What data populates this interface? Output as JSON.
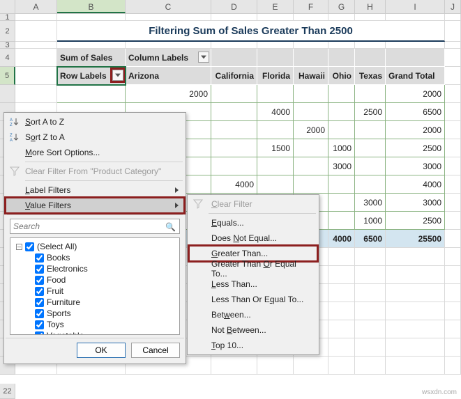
{
  "columns": [
    "A",
    "B",
    "C",
    "D",
    "E",
    "F",
    "G",
    "H",
    "I",
    "J"
  ],
  "selectedColumn": "B",
  "selectedRow": 5,
  "title": "Filtering Sum of Sales Greater Than 2500",
  "pivot": {
    "headerLabel": "Sum of Sales",
    "columnsLabel": "Column Labels",
    "rowLabel": "Row Labels",
    "cols": [
      "Arizona",
      "California",
      "Florida",
      "Hawaii",
      "Ohio",
      "Texas",
      "Grand Total"
    ],
    "rows": [
      {
        "values": [
          "2000",
          "",
          "",
          "",
          "",
          "",
          "2000"
        ]
      },
      {
        "values": [
          "",
          "",
          "4000",
          "",
          "",
          "2500",
          "6500"
        ]
      },
      {
        "values": [
          "",
          "",
          "",
          "2000",
          "",
          "",
          "2000"
        ]
      },
      {
        "values": [
          "",
          "",
          "1500",
          "",
          "1000",
          "",
          "2500"
        ]
      },
      {
        "values": [
          "",
          "",
          "",
          "",
          "3000",
          "",
          "3000"
        ]
      },
      {
        "values": [
          "",
          "4000",
          "",
          "",
          "",
          "",
          "4000"
        ]
      },
      {
        "values": [
          "",
          "",
          "",
          "",
          "",
          "3000",
          "3000"
        ]
      },
      {
        "values": [
          "",
          "",
          "",
          "",
          "",
          "1000",
          "2500"
        ]
      }
    ],
    "grandTotals": [
      "",
      "",
      "",
      "",
      "4000",
      "6500",
      "25500"
    ]
  },
  "menu1": {
    "sortAZ": "Sort A to Z",
    "sortZA": "Sort Z to A",
    "moreSort": "More Sort Options...",
    "clearFilter": "Clear Filter From \"Product Category\"",
    "labelFilters": "Label Filters",
    "valueFilters": "Value Filters",
    "searchPlaceholder": "Search",
    "items": [
      "(Select All)",
      "Books",
      "Electronics",
      "Food",
      "Fruit",
      "Furniture",
      "Sports",
      "Toys",
      "Vegetable"
    ],
    "ok": "OK",
    "cancel": "Cancel"
  },
  "menu2": {
    "clear": "Clear Filter",
    "equals": "Equals...",
    "notEqual": "Does Not Equal...",
    "greater": "Greater Than...",
    "gte": "Greater Than Or Equal To...",
    "less": "Less Than...",
    "lte": "Less Than Or Equal To...",
    "between": "Between...",
    "notBetween": "Not Between...",
    "top10": "Top 10..."
  },
  "watermark": "wsxdn.com"
}
